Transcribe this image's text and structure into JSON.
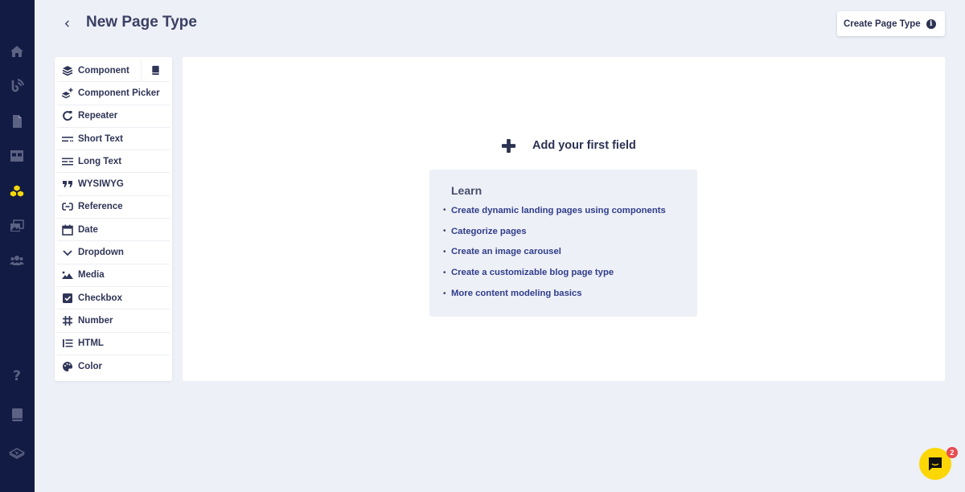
{
  "nav": {
    "items": [
      {
        "id": "home",
        "icon": "home-icon",
        "active": false
      },
      {
        "id": "feeds",
        "icon": "feed-icon",
        "active": false
      },
      {
        "id": "pages",
        "icon": "page-icon",
        "active": false
      },
      {
        "id": "tables",
        "icon": "table-icon",
        "active": false
      },
      {
        "id": "components",
        "icon": "components-icon",
        "active": true
      },
      {
        "id": "media",
        "icon": "media-gallery-icon",
        "active": false
      },
      {
        "id": "users",
        "icon": "users-icon",
        "active": false
      }
    ],
    "bottom": [
      {
        "id": "help",
        "icon": "help-icon"
      },
      {
        "id": "docs",
        "icon": "book-icon"
      },
      {
        "id": "learn",
        "icon": "academy-icon"
      }
    ],
    "active_color": "#f5d90a",
    "icon_color": "#5c6284"
  },
  "header": {
    "back_label": "Back",
    "title": "New Page Type",
    "create_button": "Create Page Type",
    "info_glyph": "i"
  },
  "palette": {
    "items": [
      {
        "label": "Component",
        "icon": "layers-icon"
      },
      {
        "label": "Component Picker",
        "icon": "layers-plus-icon"
      },
      {
        "label": "Repeater",
        "icon": "repeat-icon"
      },
      {
        "label": "Short Text",
        "icon": "short-text-icon"
      },
      {
        "label": "Long Text",
        "icon": "long-text-icon"
      },
      {
        "label": "WYSIWYG",
        "icon": "quote-icon"
      },
      {
        "label": "Reference",
        "icon": "link-icon"
      },
      {
        "label": "Date",
        "icon": "calendar-icon"
      },
      {
        "label": "Dropdown",
        "icon": "chevron-down-icon"
      },
      {
        "label": "Media",
        "icon": "image-icon"
      },
      {
        "label": "Checkbox",
        "icon": "checkbox-icon"
      },
      {
        "label": "Number",
        "icon": "hash-icon"
      },
      {
        "label": "HTML",
        "icon": "list-icon"
      },
      {
        "label": "Color",
        "icon": "palette-icon"
      }
    ]
  },
  "canvas": {
    "add_field_label": "Add your first field",
    "learn": {
      "title": "Learn",
      "links": [
        "Create dynamic landing pages using components",
        "Categorize pages",
        "Create an image carousel",
        "Create a customizable blog page type",
        "More content modeling basics"
      ]
    }
  },
  "chat": {
    "badge_count": "2"
  }
}
